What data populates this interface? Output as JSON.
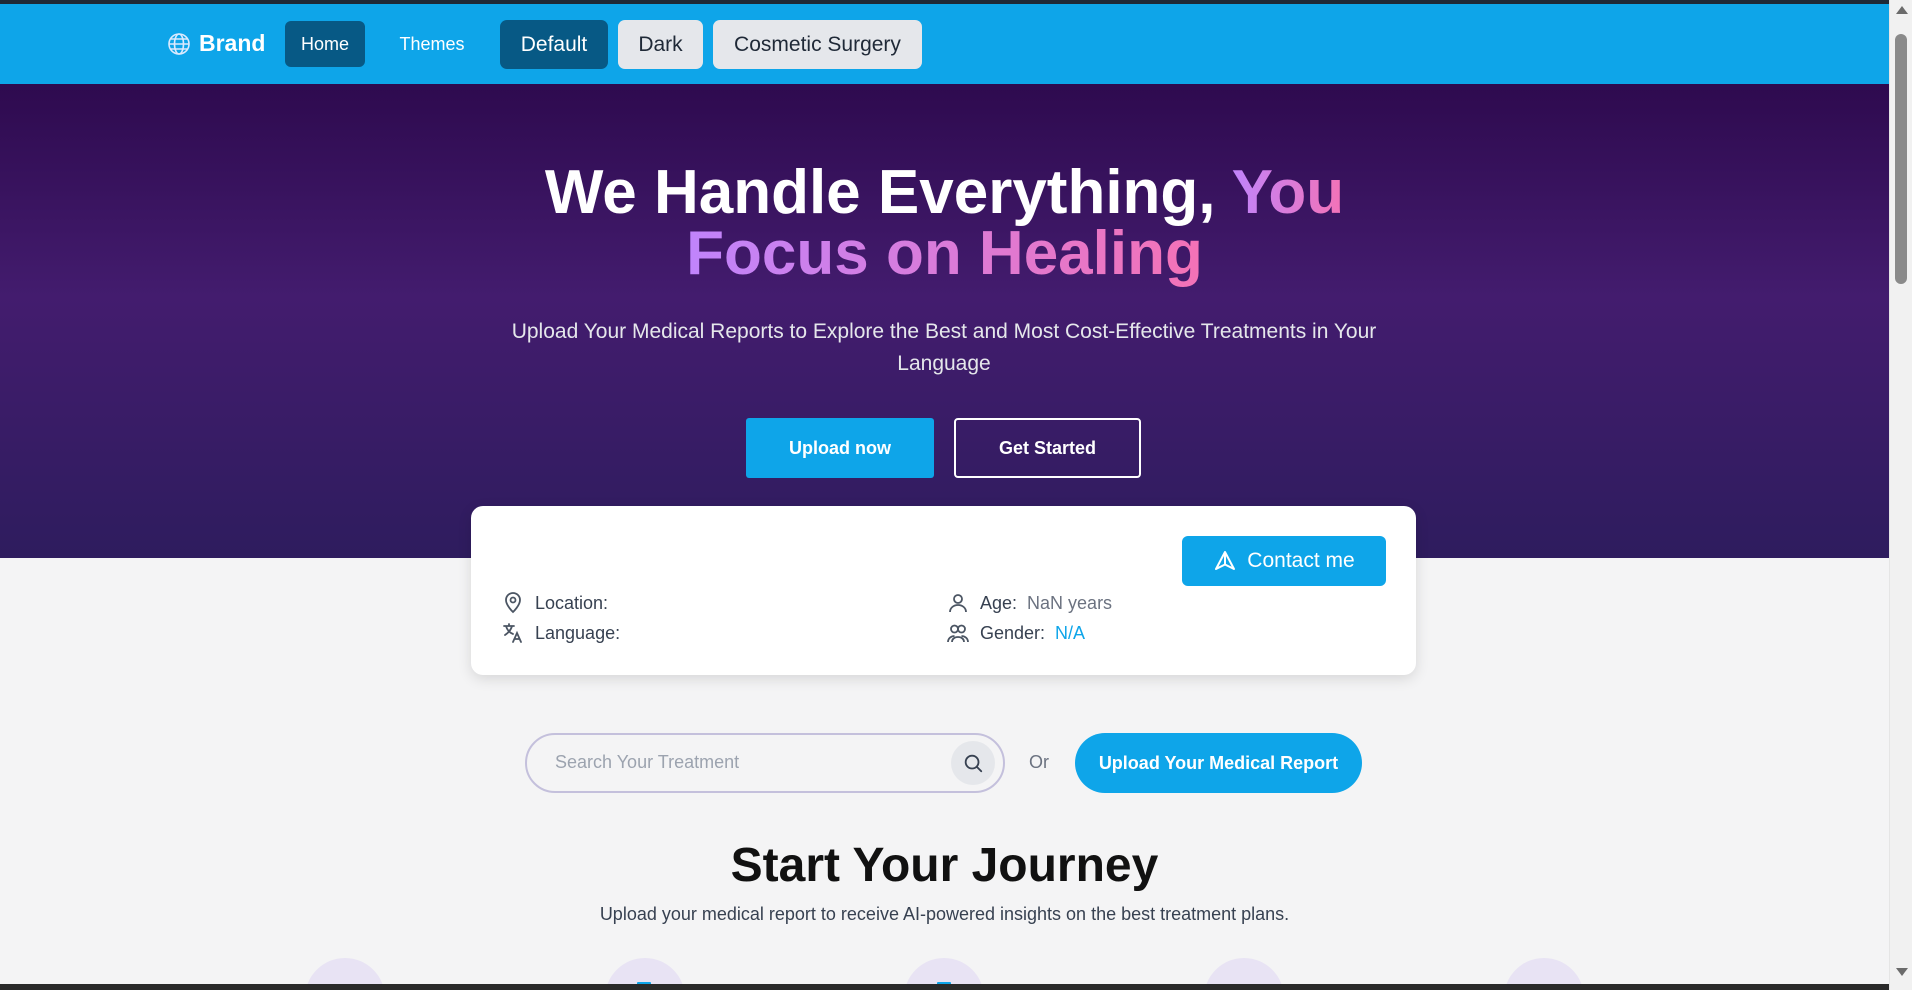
{
  "navbar": {
    "brand": "Brand",
    "links": {
      "home": "Home",
      "themes": "Themes"
    },
    "themes": {
      "default": "Default",
      "dark": "Dark",
      "cosmetic": "Cosmetic Surgery"
    },
    "background_color": "#0ea5e9",
    "active_color": "#075985"
  },
  "hero": {
    "title_white": "We Handle Everything,",
    "title_grad_1": "You",
    "title_grad_2": "Focus on Healing",
    "subtitle": "Upload Your Medical Reports to Explore the Best and Most Cost-Effective Treatments in Your Language",
    "upload_button": "Upload now",
    "started_button": "Get Started"
  },
  "profile": {
    "contact_button": "Contact me",
    "location_label": "Location:",
    "location_value": "",
    "language_label": "Language:",
    "language_value": "",
    "age_label": "Age:",
    "age_value": "NaN years",
    "gender_label": "Gender:",
    "gender_value": "N/A"
  },
  "search": {
    "placeholder": "Search Your Treatment",
    "or_text": "Or",
    "report_button": "Upload Your Medical Report"
  },
  "journey": {
    "title": "Start Your Journey",
    "subtitle": "Upload your medical report to receive AI-powered insights on the best treatment plans."
  },
  "icons": {
    "brand": "globe-icon",
    "contact": "navigation-icon",
    "location": "map-pin-icon",
    "language": "translate-icon",
    "age": "user-icon",
    "gender": "users-icon",
    "search": "search-icon"
  },
  "colors": {
    "accent": "#0ea5e9",
    "hero_top": "#2e0a4f",
    "grad_start": "#c084fc",
    "grad_end": "#f472b6"
  }
}
